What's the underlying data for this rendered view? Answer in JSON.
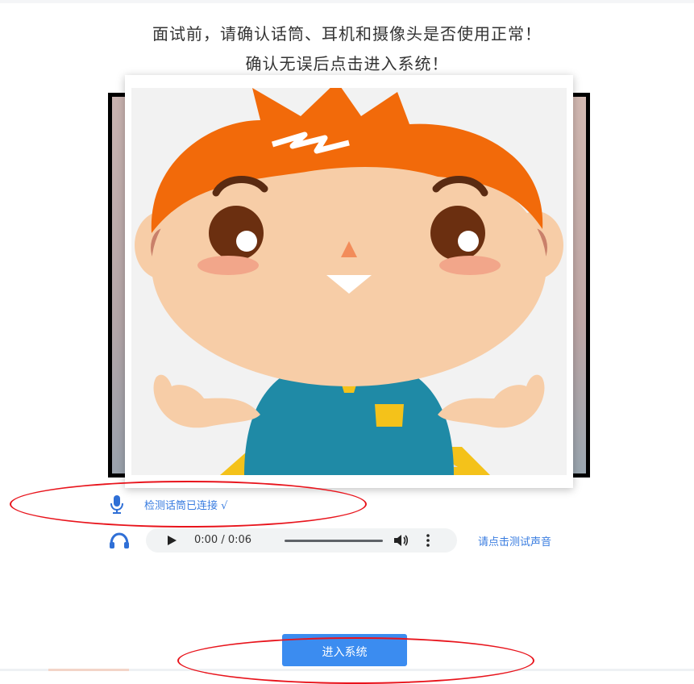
{
  "instructions": {
    "line1": "面试前，请确认话筒、耳机和摄像头是否使用正常！",
    "line2": "确认无误后点击进入系统！"
  },
  "microphone": {
    "icon": "microphone-icon",
    "status": "检测话筒已连接 √"
  },
  "audio": {
    "icon": "headphones-icon",
    "time": "0:00 / 0:06",
    "test_link": "请点击测试声音"
  },
  "enter_button": "进入系统",
  "colors": {
    "link": "#3a7de0",
    "primary": "#3b8cf0",
    "annotation": "#e8141c"
  }
}
